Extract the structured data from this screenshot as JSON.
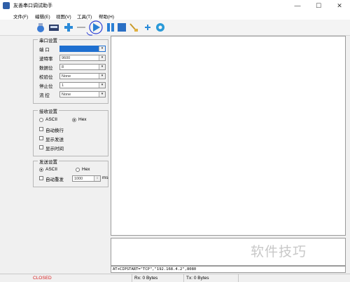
{
  "window": {
    "title": "友善串口调试助手",
    "minimize": "—",
    "maximize": "☐",
    "close": "✕"
  },
  "menubar": {
    "items": [
      "文件(F)",
      "编辑(E)",
      "视图(V)",
      "工具(T)",
      "帮助(H)"
    ]
  },
  "toolbar": {
    "icons": [
      "open-icon",
      "save-log-icon",
      "add-icon",
      "remove-icon",
      "start-icon",
      "pause-icon",
      "stop-icon",
      "clear-icon",
      "add-small-icon",
      "settings-gear-icon"
    ],
    "annotation_color": "#2b3fd6"
  },
  "port_settings": {
    "title": "串口设置",
    "rows": [
      {
        "label": "端  口",
        "value": ""
      },
      {
        "label": "波特率",
        "value": "9600"
      },
      {
        "label": "数据位",
        "value": "8"
      },
      {
        "label": "校验位",
        "value": "None"
      },
      {
        "label": "停止位",
        "value": "1"
      },
      {
        "label": "流  控",
        "value": "None"
      }
    ],
    "port_selected_color": "#1e6fd0"
  },
  "recv_settings": {
    "title": "接收设置",
    "ascii": "ASCII",
    "hex": "Hex",
    "auto_newline": "自动换行",
    "show_send": "显示发送",
    "show_time": "显示时间"
  },
  "send_settings": {
    "title": "发送设置",
    "ascii": "ASCII",
    "hex": "Hex",
    "auto_resend": "自动重发",
    "interval_value": "1000",
    "interval_unit": "ms"
  },
  "command_input": {
    "value": "AT+CIPSTART=\"TCP\",\"192.168.4.2\",8080"
  },
  "status": {
    "state": "CLOSED",
    "state_color": "#d82020",
    "rx": "Rx: 0 Bytes",
    "tx": "Tx: 0 Bytes"
  },
  "watermark": "软件技巧"
}
